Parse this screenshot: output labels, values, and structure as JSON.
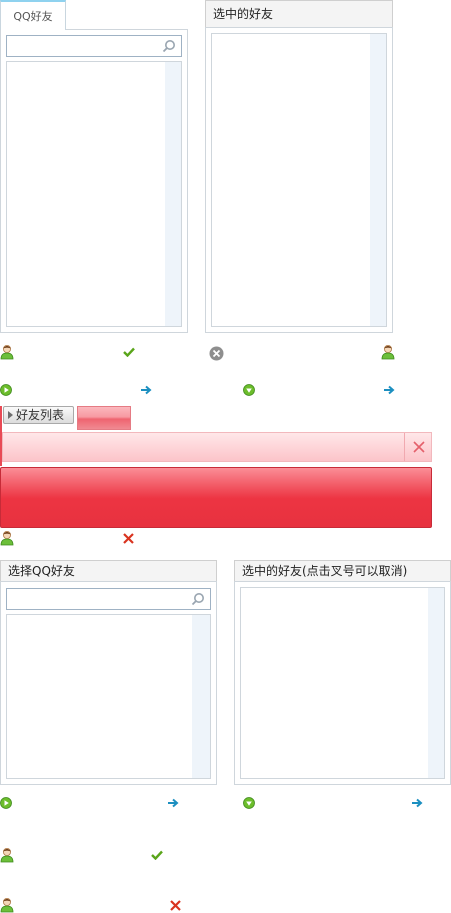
{
  "top_left_panel": {
    "tab_label": "QQ好友"
  },
  "top_right_panel": {
    "title": "选中的好友"
  },
  "friend_list_button": {
    "label": "好友列表"
  },
  "bottom_left_panel": {
    "title": "选择QQ好友"
  },
  "bottom_right_panel": {
    "title": "选中的好友(点击叉号可以取消)"
  },
  "icons": {
    "user": "user-avatar-icon",
    "check": "check-icon",
    "remove": "remove-circle-icon",
    "play": "play-circle-icon",
    "down": "down-circle-icon",
    "arrow": "arrow-right-icon",
    "x": "x-icon",
    "search": "search-icon"
  },
  "colors": {
    "green": "#5aa51a",
    "blue_arrow": "#1c8fc0",
    "red_x": "#d9331f",
    "red_bar": "#ed3442",
    "pink_bar": "#fcc4c9"
  }
}
